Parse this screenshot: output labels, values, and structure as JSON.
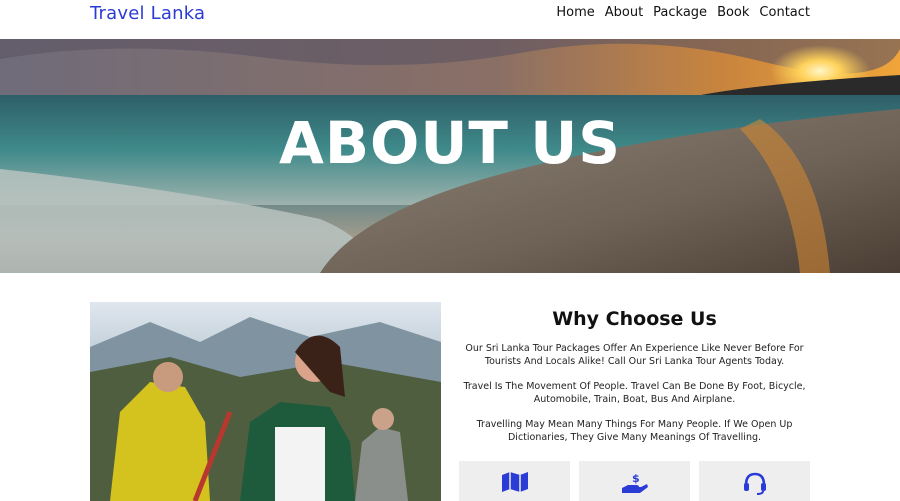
{
  "navbar": {
    "logo": "Travel Lanka",
    "links": [
      "Home",
      "About",
      "Package",
      "Book",
      "Contact"
    ]
  },
  "hero": {
    "title": "ABOUT US"
  },
  "why_choose": {
    "title": "Why Choose Us",
    "paragraphs": [
      "Our Sri Lanka Tour Packages Offer An Experience Like Never Before For Tourists And Locals Alike! Call Our Sri Lanka Tour Agents Today.",
      "Travel Is The Movement Of People. Travel Can Be Done By Foot, Bicycle, Automobile, Train, Boat, Bus And Airplane.",
      "Travelling May Mean Many Things For Many People. If We Open Up Dictionaries, They Give Many Meanings Of Travelling."
    ]
  },
  "feature_cards": [
    {
      "icon": "map-icon"
    },
    {
      "icon": "hand-dollar-icon"
    },
    {
      "icon": "headset-icon"
    }
  ],
  "colors": {
    "brand": "#2b3bd6",
    "card_bg": "#eeeeee"
  }
}
